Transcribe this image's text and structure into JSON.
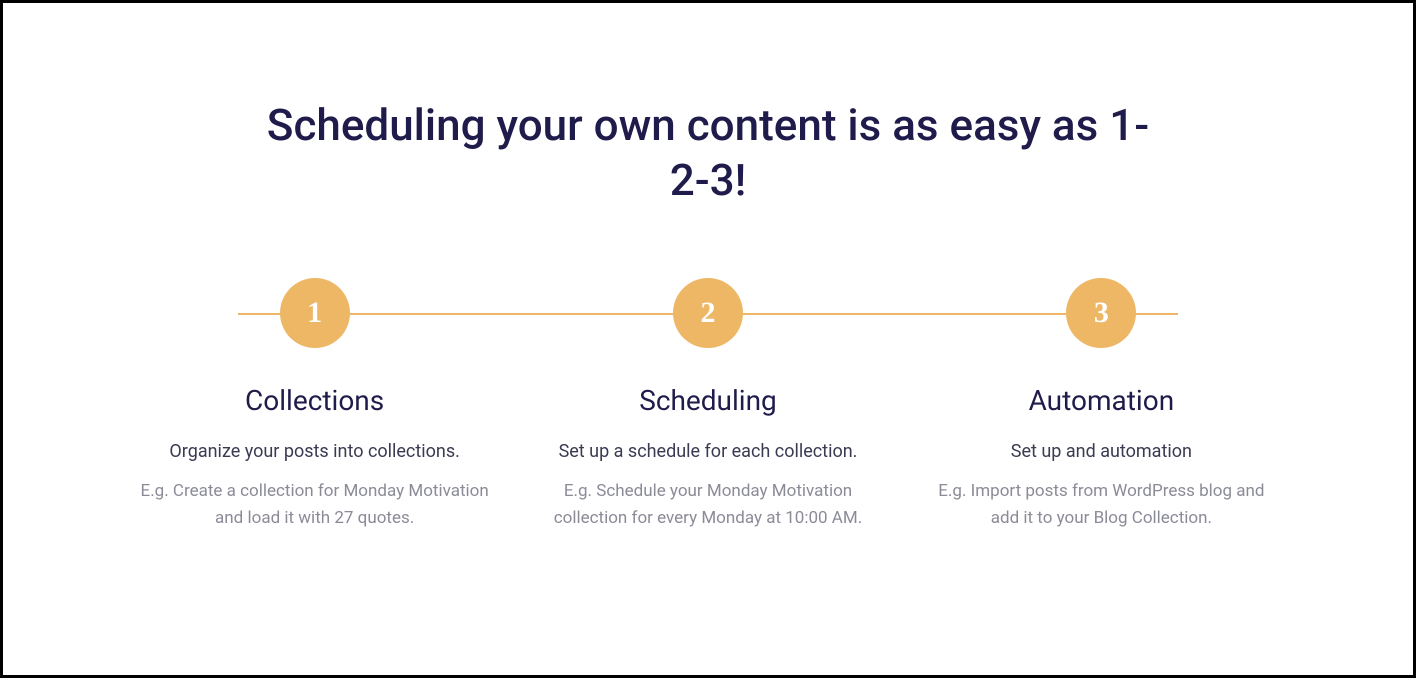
{
  "heading": "Scheduling your own content is as easy as 1-2-3!",
  "steps": [
    {
      "number": "1",
      "title": "Collections",
      "description": "Organize your posts into collections.",
      "example": "E.g. Create a collection for Monday Motivation and load it with 27 quotes."
    },
    {
      "number": "2",
      "title": "Scheduling",
      "description": "Set up a schedule for each collection.",
      "example": "E.g. Schedule your Monday Motivation collection for every Monday at 10:00 AM."
    },
    {
      "number": "3",
      "title": "Automation",
      "description": "Set up and automation",
      "example": "E.g. Import posts from WordPress blog and add it to your Blog Collection."
    }
  ]
}
